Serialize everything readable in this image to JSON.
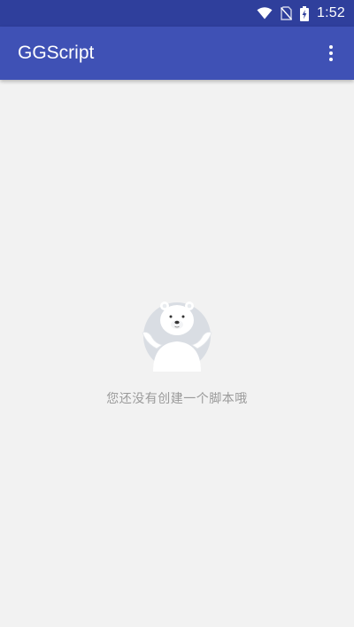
{
  "status_bar": {
    "time": "1:52",
    "icons": [
      "wifi-icon",
      "no-sim-icon",
      "battery-charging-icon"
    ]
  },
  "app_bar": {
    "title": "GGScript",
    "menu_icon": "more-vert-icon",
    "color": "#3f51b5"
  },
  "empty_state": {
    "illustration": "polar-bear-shrug-icon",
    "message": "您还没有创建一个脚本哦"
  }
}
